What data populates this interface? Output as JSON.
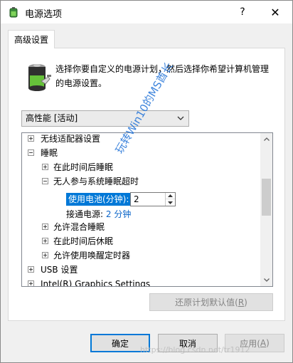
{
  "window": {
    "title": "电源选项",
    "help_glyph": "?",
    "close_glyph": "✕"
  },
  "tab": {
    "label": "高级设置"
  },
  "description": "选择你要自定义的电源计划，然后选择你希望计算机管理的电源设置。",
  "plan_select": {
    "value": "高性能 [活动]"
  },
  "tree": {
    "items": [
      {
        "label": "无线适配器设置",
        "expanded": false
      },
      {
        "label": "睡眠",
        "expanded": true
      },
      {
        "label": "在此时间后睡眠",
        "expanded": false
      },
      {
        "label": "无人参与系统睡眠超时",
        "expanded": true
      },
      {
        "label": "允许混合睡眠",
        "expanded": false
      },
      {
        "label": "在此时间后休眠",
        "expanded": false
      },
      {
        "label": "允许使用唤醒定时器",
        "expanded": false
      },
      {
        "label": "USB 设置",
        "expanded": false
      },
      {
        "label": "Intel(R) Graphics Settings",
        "expanded": false
      }
    ],
    "on_battery_label": "使用电池(分钟):",
    "on_battery_value": "2",
    "plugged_in_label": "接通电源:",
    "plugged_in_value": "2 分钟"
  },
  "restore_button": {
    "label_prefix": "还原计划默认值(",
    "hotkey": "R",
    "label_suffix": ")"
  },
  "footer": {
    "ok": "确定",
    "cancel": "取消",
    "apply_prefix": "应用(",
    "apply_hotkey": "A",
    "apply_suffix": ")"
  },
  "watermarks": {
    "diagonal": "玩转Win10的MS酋长",
    "url": "https://blog.csdn.net/tr1912"
  },
  "colors": {
    "selection": "#0078d7",
    "link_value": "#0a64c8",
    "watermark": "#1c6fd6"
  }
}
